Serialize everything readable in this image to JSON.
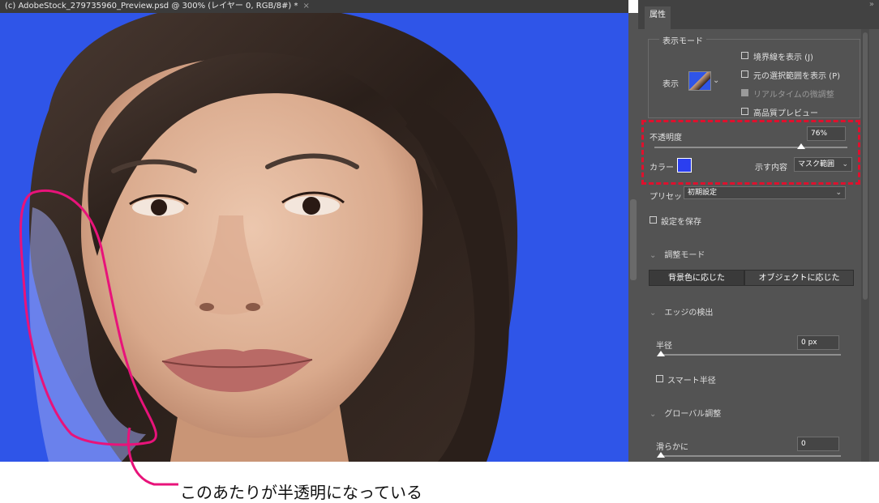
{
  "document": {
    "tab_title": "(c) AdobeStock_279735960_Preview.psd @ 300% (レイヤー 0, RGB/8#) *",
    "close_glyph": "×"
  },
  "panel": {
    "tab_label": "属性",
    "grip": "»",
    "view_mode": {
      "legend": "表示モード",
      "view_label": "表示",
      "options": [
        {
          "label": "境界線を表示 (J)",
          "checked": false,
          "disabled": false
        },
        {
          "label": "元の選択範囲を表示 (P)",
          "checked": false,
          "disabled": false
        },
        {
          "label": "リアルタイムの微調整",
          "checked": true,
          "disabled": true
        },
        {
          "label": "高品質プレビュー",
          "checked": false,
          "disabled": false
        }
      ]
    },
    "opacity": {
      "label": "不透明度",
      "value": "76%",
      "fraction": 0.76
    },
    "color": {
      "label": "カラー",
      "swatch": "#2b3ff0"
    },
    "show": {
      "label": "示す内容",
      "value": "マスク範囲"
    },
    "preset": {
      "label": "プリセット",
      "value": "初期設定"
    },
    "save_settings": {
      "label": "設定を保存",
      "checked": false
    },
    "adjust_mode": {
      "heading": "調整モード",
      "buttons": [
        "背景色に応じた",
        "オブジェクトに応じた"
      ],
      "selected": 0
    },
    "edge_detection": {
      "heading": "エッジの検出",
      "radius_label": "半径",
      "radius_value": "0 px",
      "radius_fraction": 0.0,
      "smart_radius": {
        "label": "スマート半径",
        "checked": false
      }
    },
    "global_adjust": {
      "heading": "グローバル調整",
      "smooth_label": "滑らかに",
      "smooth_value": "0",
      "smooth_fraction": 0.0
    }
  },
  "annotation": {
    "text": "このあたりが半透明になっている",
    "highlight_color": "#e0102d",
    "stroke_color": "#e8137a"
  },
  "colors": {
    "canvas_blue": "#2f55e8",
    "panel_bg": "#535353"
  }
}
